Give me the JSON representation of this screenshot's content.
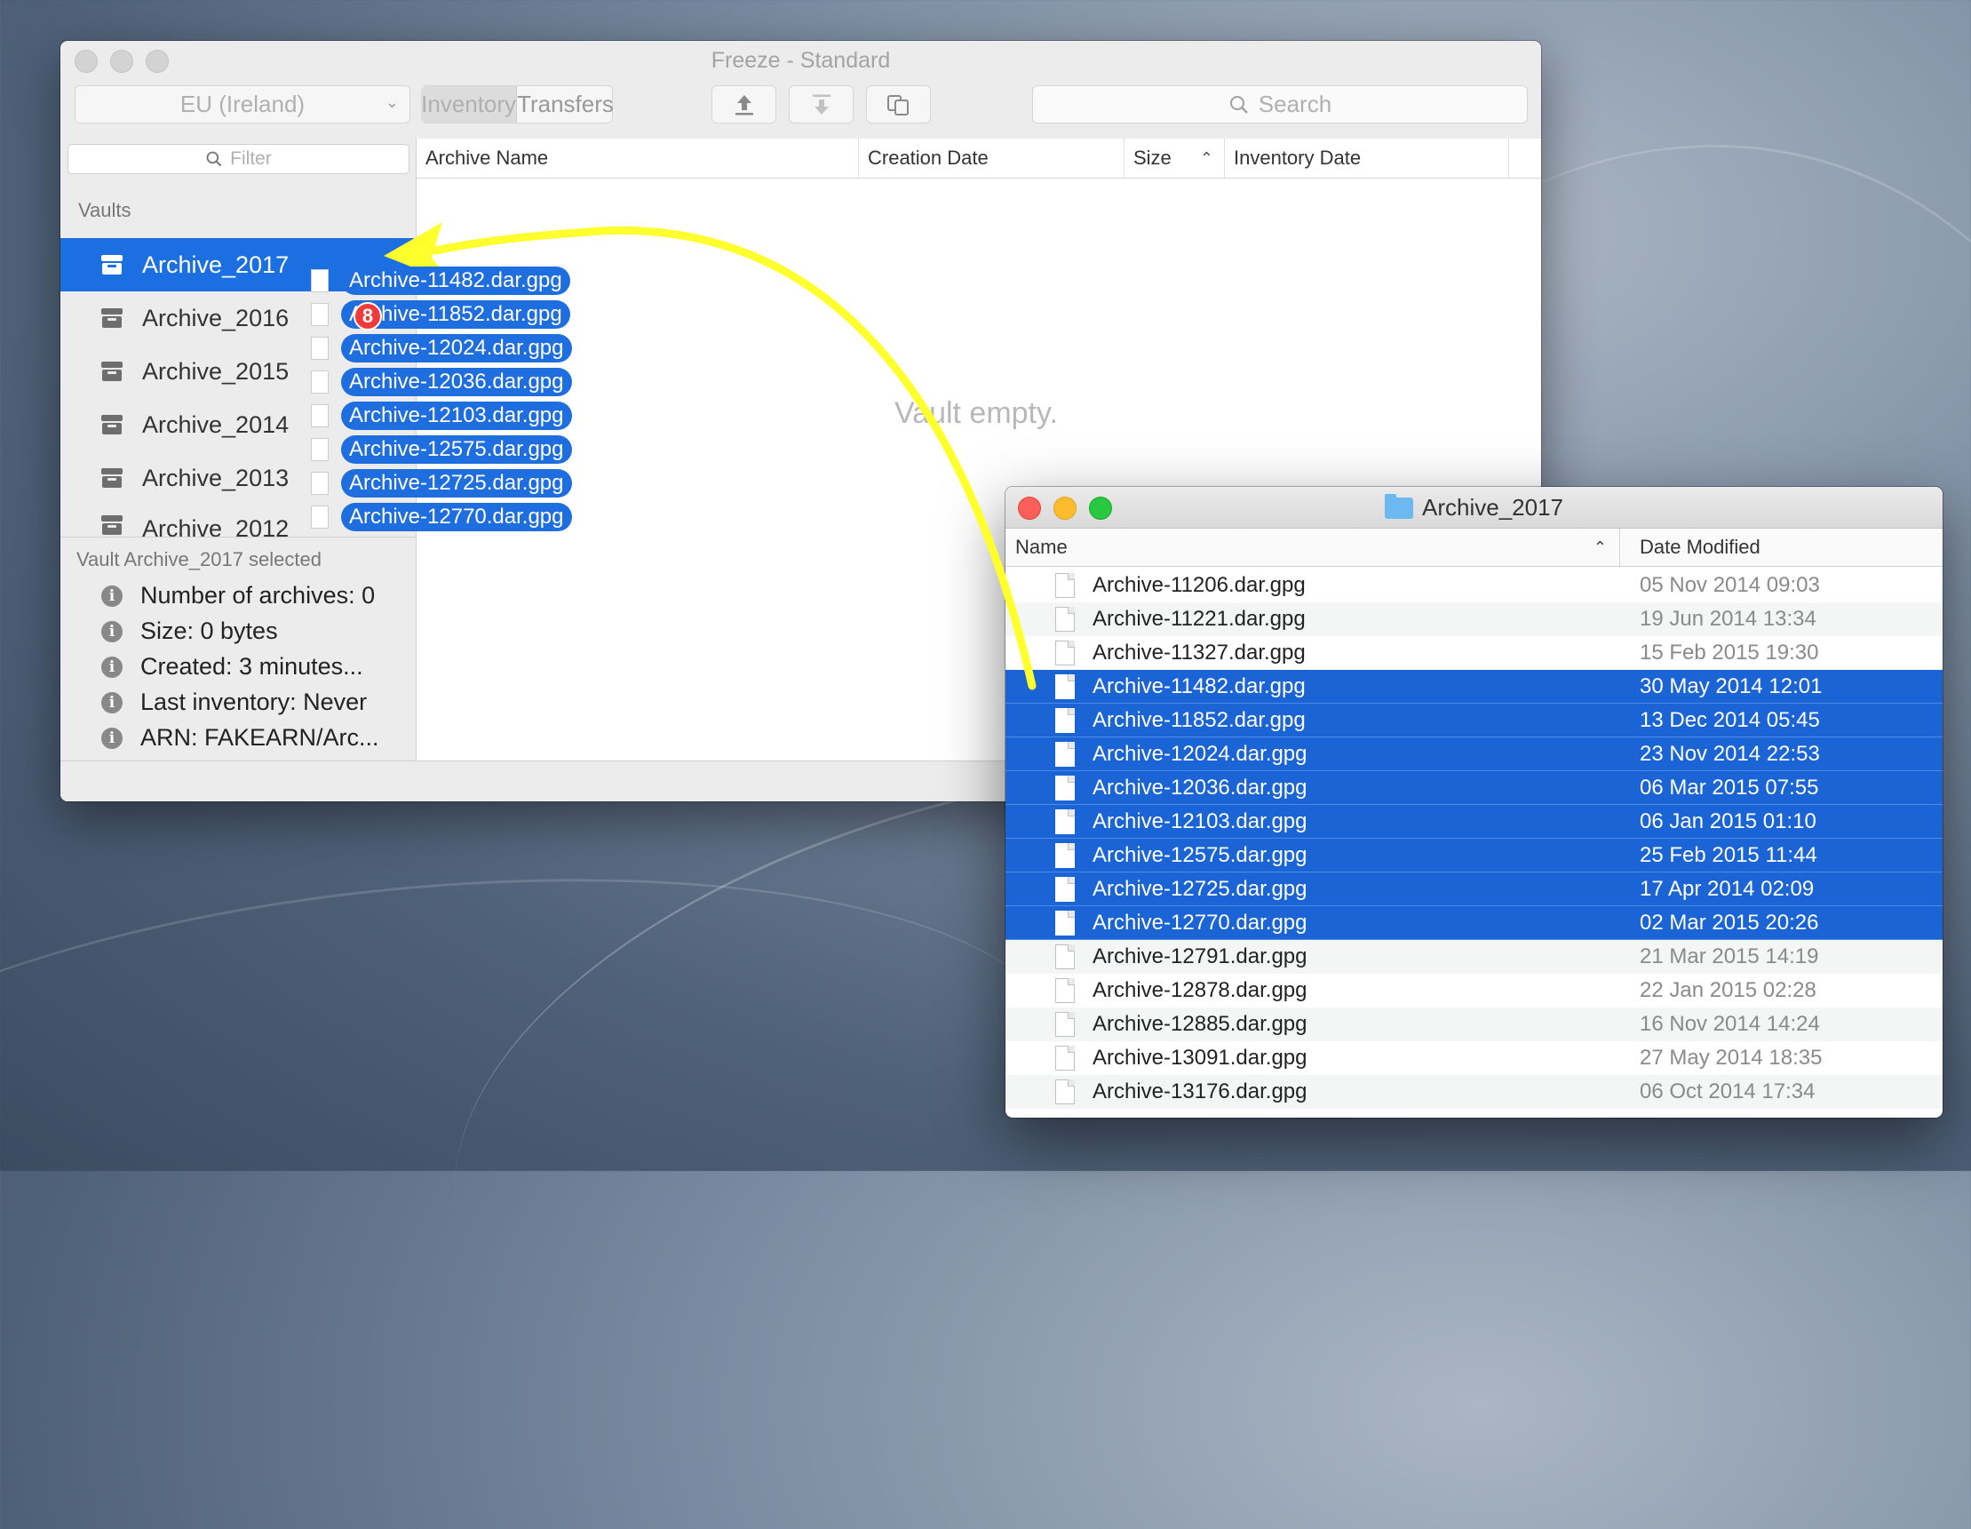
{
  "freeze": {
    "title": "Freeze - Standard",
    "region": "EU (Ireland)",
    "tabs": [
      "Inventory",
      "Transfers"
    ],
    "search_placeholder": "Search",
    "filter_placeholder": "Filter",
    "vaults_label": "Vaults",
    "vaults": [
      "Archive_2017",
      "Archive_2016",
      "Archive_2015",
      "Archive_2014",
      "Archive_2013",
      "Archive_2012"
    ],
    "selected_vault_index": 0,
    "columns": [
      "Archive Name",
      "Creation Date",
      "Size",
      "Inventory Date"
    ],
    "empty_text": "Vault empty.",
    "details": {
      "title": "Vault Archive_2017 selected",
      "items": [
        "Number of archives: 0",
        "Size: 0 bytes",
        "Created: 3 minutes...",
        "Last inventory: Never",
        "ARN: FAKEARN/Arc..."
      ]
    },
    "colors": {
      "selection": "#1b6fe0"
    }
  },
  "drag": {
    "count_badge": "8",
    "files": [
      "Archive-11482.dar.gpg",
      "Archive-11852.dar.gpg",
      "Archive-12024.dar.gpg",
      "Archive-12036.dar.gpg",
      "Archive-12103.dar.gpg",
      "Archive-12575.dar.gpg",
      "Archive-12725.dar.gpg",
      "Archive-12770.dar.gpg"
    ]
  },
  "finder": {
    "title": "Archive_2017",
    "columns": [
      "Name",
      "Date Modified"
    ],
    "rows": [
      {
        "name": "Archive-11206.dar.gpg",
        "date": "05 Nov 2014 09:03",
        "selected": false
      },
      {
        "name": "Archive-11221.dar.gpg",
        "date": "19 Jun 2014 13:34",
        "selected": false
      },
      {
        "name": "Archive-11327.dar.gpg",
        "date": "15 Feb 2015 19:30",
        "selected": false
      },
      {
        "name": "Archive-11482.dar.gpg",
        "date": "30 May 2014 12:01",
        "selected": true
      },
      {
        "name": "Archive-11852.dar.gpg",
        "date": "13 Dec 2014 05:45",
        "selected": true
      },
      {
        "name": "Archive-12024.dar.gpg",
        "date": "23 Nov 2014 22:53",
        "selected": true
      },
      {
        "name": "Archive-12036.dar.gpg",
        "date": "06 Mar 2015 07:55",
        "selected": true
      },
      {
        "name": "Archive-12103.dar.gpg",
        "date": "06 Jan 2015 01:10",
        "selected": true
      },
      {
        "name": "Archive-12575.dar.gpg",
        "date": "25 Feb 2015 11:44",
        "selected": true
      },
      {
        "name": "Archive-12725.dar.gpg",
        "date": "17 Apr 2014 02:09",
        "selected": true
      },
      {
        "name": "Archive-12770.dar.gpg",
        "date": "02 Mar 2015 20:26",
        "selected": true
      },
      {
        "name": "Archive-12791.dar.gpg",
        "date": "21 Mar 2015 14:19",
        "selected": false
      },
      {
        "name": "Archive-12878.dar.gpg",
        "date": "22 Jan 2015 02:28",
        "selected": false
      },
      {
        "name": "Archive-12885.dar.gpg",
        "date": "16 Nov 2014 14:24",
        "selected": false
      },
      {
        "name": "Archive-13091.dar.gpg",
        "date": "27 May 2014 18:35",
        "selected": false
      },
      {
        "name": "Archive-13176.dar.gpg",
        "date": "06 Oct 2014 17:34",
        "selected": false
      }
    ],
    "colors": {
      "selection": "#1b64d6"
    }
  },
  "annotation": {
    "arrow_color": "#ffff2e"
  }
}
